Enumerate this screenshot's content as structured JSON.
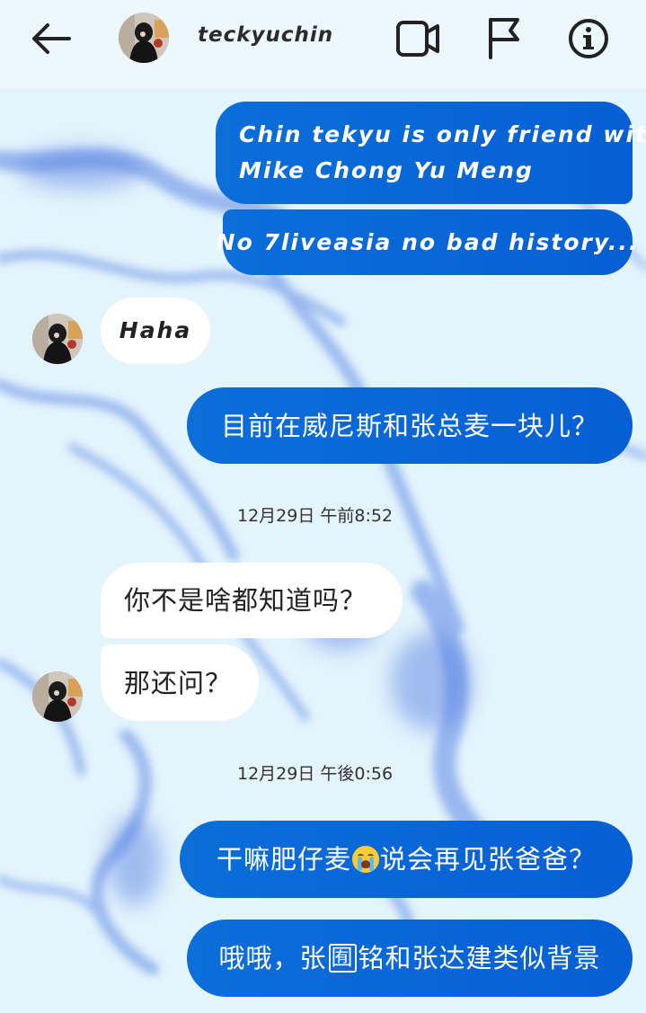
{
  "header": {
    "contact_name": "teckyuchin",
    "icons": {
      "back": "arrow-left-icon",
      "video": "video-camera-icon",
      "flag": "flag-icon",
      "info": "info-icon"
    }
  },
  "colors": {
    "outgoing_bubble": "#0a66d8",
    "incoming_bubble": "#ffffff",
    "header_bg": "#ecf8fd",
    "chat_bg_base": "#dff2fb",
    "chat_bg_pattern": "#5a86e6"
  },
  "messages": [
    {
      "from": "me",
      "lines": [
        "Chin tekyu is only friend with",
        "Mike Chong Yu Meng"
      ]
    },
    {
      "from": "me",
      "text": "No 7liveasia no bad history..."
    },
    {
      "from": "them",
      "text": "Haha"
    },
    {
      "from": "me",
      "text": "目前在威尼斯和张总麦一块儿？"
    },
    {
      "timestamp": "12月29日 午前8:52"
    },
    {
      "from": "them",
      "text": "你不是啥都知道吗？"
    },
    {
      "from": "them",
      "text": "那还问？"
    },
    {
      "timestamp": "12月29日 午後0:56"
    },
    {
      "from": "me",
      "text_before": "干嘛肥仔麦",
      "emoji": "loudly-crying-face-icon",
      "text_after": "说会再见张爸爸？"
    },
    {
      "from": "me",
      "text_before": "哦哦，张",
      "boxed_char": "囿",
      "text_after": "铭和张达建类似背景"
    }
  ]
}
